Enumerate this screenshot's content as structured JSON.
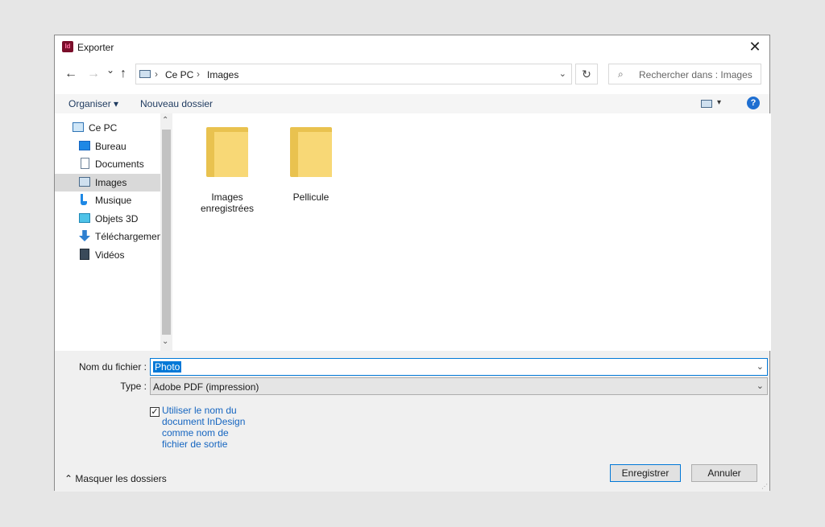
{
  "window": {
    "app_icon_text": "Id",
    "title": "Exporter",
    "close_glyph": "✕",
    "app_color": "#7a0e2a"
  },
  "nav": {
    "back_glyph": "←",
    "forward_glyph": "→",
    "recent_glyph": "⌄",
    "up_glyph": "↑",
    "breadcrumbs": [
      "Ce PC",
      "Images"
    ],
    "crumb_sep": "›",
    "dropdown_glyph": "⌄",
    "refresh_glyph": "↻",
    "search_glyph": "⌕",
    "search_placeholder": "Rechercher dans : Images"
  },
  "toolbar": {
    "organize_label": "Organiser ▾",
    "new_folder_label": "Nouveau dossier",
    "view_caret": "▾",
    "help_glyph": "?"
  },
  "sidebar": {
    "scroll_up": "⌃",
    "scroll_down": "⌄",
    "items": [
      {
        "label": "Ce PC",
        "icon": "computer-icon",
        "indent": 0
      },
      {
        "label": "Bureau",
        "icon": "desktop-icon",
        "indent": 1
      },
      {
        "label": "Documents",
        "icon": "documents-icon",
        "indent": 1
      },
      {
        "label": "Images",
        "icon": "pictures-icon",
        "indent": 1,
        "selected": true
      },
      {
        "label": "Musique",
        "icon": "music-icon",
        "indent": 1
      },
      {
        "label": "Objets 3D",
        "icon": "3d-objects-icon",
        "indent": 1
      },
      {
        "label": "Téléchargements",
        "icon": "downloads-icon",
        "indent": 1
      },
      {
        "label": "Vidéos",
        "icon": "videos-icon",
        "indent": 1
      }
    ]
  },
  "content": {
    "folders": [
      {
        "line1": "Images",
        "line2": "enregistrées",
        "icon": "folder-icon"
      },
      {
        "line1": "Pellicule",
        "line2": "",
        "icon": "folder-icon"
      }
    ]
  },
  "form": {
    "filename_label": "Nom du fichier :",
    "filename_value": "Photo",
    "type_label": "Type :",
    "type_value": "Adobe PDF (impression)",
    "caret": "⌄",
    "checkbox_checked": true,
    "checkbox_mark": "✓",
    "checkbox_label": "Utiliser le nom du document InDesign comme nom de fichier de sortie",
    "hide_folders_label": "⌃  Masquer les dossiers",
    "save_label": "Enregistrer",
    "cancel_label": "Annuler",
    "grip": "⋰"
  }
}
